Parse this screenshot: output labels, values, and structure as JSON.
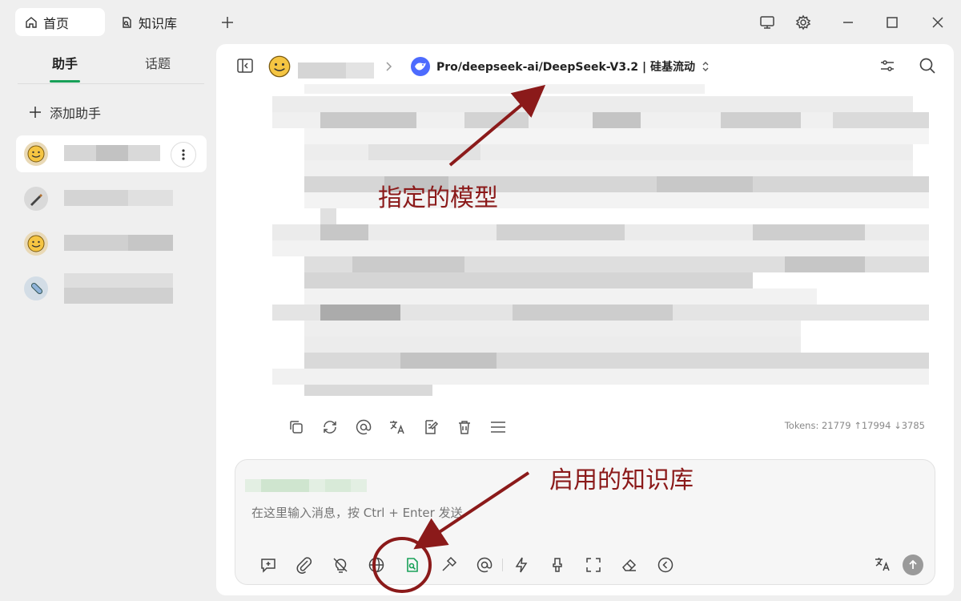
{
  "tabs": [
    {
      "label": "首页",
      "icon": "home-icon"
    },
    {
      "label": "知识库",
      "icon": "knowledge-base-icon"
    }
  ],
  "sidebar": {
    "tabs": [
      "助手",
      "话题"
    ],
    "add_assistant": "添加助手",
    "accent_color": "#18a058"
  },
  "header": {
    "model": "Pro/deepseek-ai/DeepSeek-V3.2 | 硅基流动"
  },
  "message": {
    "tokens": "Tokens: 21779 ↑17994 ↓3785"
  },
  "input": {
    "placeholder": "在这里输入消息，按 Ctrl + Enter 发送"
  },
  "annotations": {
    "model_note": "指定的模型",
    "kb_note": "启用的知识库",
    "color": "#8b1a1a"
  }
}
